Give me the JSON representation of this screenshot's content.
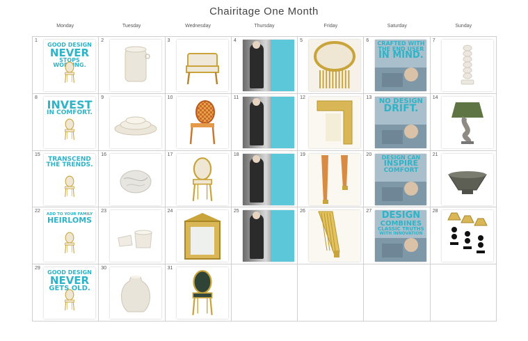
{
  "calendar": {
    "title": "Chairitage One Month",
    "weekdays": [
      "Monday",
      "Tuesday",
      "Wednesday",
      "Thursday",
      "Friday",
      "Saturday",
      "Sunday"
    ],
    "days": [
      {
        "n": "1",
        "kind": "quote",
        "lines": [
          "GOOD DESIGN",
          "NEVER",
          "STOPS WORKING."
        ],
        "sizes": [
          8,
          15,
          8
        ],
        "icon": "gold-chair-icon"
      },
      {
        "n": "2",
        "kind": "product",
        "icon": "ceramic-jar-icon"
      },
      {
        "n": "3",
        "kind": "product",
        "icon": "armchair-icon"
      },
      {
        "n": "4",
        "kind": "bw",
        "icon": "portrait-photo-icon"
      },
      {
        "n": "5",
        "kind": "product",
        "icon": "chair-back-detail-icon"
      },
      {
        "n": "6",
        "kind": "photo",
        "lines": [
          "CRAFTED WITH",
          "THE END USER",
          "IN MIND."
        ],
        "sizes": [
          8,
          8,
          13
        ],
        "icon": "workshop-photo-icon"
      },
      {
        "n": "7",
        "kind": "product",
        "icon": "turned-lamp-base-icon"
      },
      {
        "n": "8",
        "kind": "quote",
        "lines": [
          "INVEST",
          "IN COMFORT."
        ],
        "sizes": [
          16,
          9
        ],
        "icon": "gold-chair-icon"
      },
      {
        "n": "9",
        "kind": "product",
        "icon": "nesting-bowls-icon"
      },
      {
        "n": "10",
        "kind": "product",
        "icon": "checkered-chair-icon"
      },
      {
        "n": "11",
        "kind": "bw",
        "icon": "portrait-photo-icon"
      },
      {
        "n": "12",
        "kind": "product",
        "icon": "gold-frame-detail-icon"
      },
      {
        "n": "13",
        "kind": "photo",
        "lines": [
          "NO DESIGN",
          "DRIFT."
        ],
        "sizes": [
          10,
          14
        ],
        "icon": "workshop-photo-icon"
      },
      {
        "n": "14",
        "kind": "product",
        "icon": "table-lamp-icon"
      },
      {
        "n": "15",
        "kind": "quote",
        "lines": [
          "TRANSCEND",
          "THE TRENDS."
        ],
        "sizes": [
          9,
          9
        ],
        "icon": "gold-chair-icon"
      },
      {
        "n": "16",
        "kind": "product",
        "icon": "marble-bowl-icon"
      },
      {
        "n": "17",
        "kind": "product",
        "icon": "oval-back-chair-icon"
      },
      {
        "n": "18",
        "kind": "bw",
        "icon": "portrait-photo-icon"
      },
      {
        "n": "19",
        "kind": "product",
        "icon": "tapered-leg-icon"
      },
      {
        "n": "20",
        "kind": "photo",
        "lines": [
          "DESIGN CAN",
          "INSPIRE",
          "COMFORT"
        ],
        "sizes": [
          8,
          11,
          9
        ],
        "icon": "workshop-photo-icon"
      },
      {
        "n": "21",
        "kind": "product",
        "icon": "stone-bowl-icon"
      },
      {
        "n": "22",
        "kind": "quote",
        "lines": [
          "ADD TO YOUR FAMILY",
          "HEIRLOMS"
        ],
        "sizes": [
          5.5,
          11
        ],
        "icon": "gold-chair-icon"
      },
      {
        "n": "23",
        "kind": "product",
        "icon": "ceramic-pieces-icon"
      },
      {
        "n": "24",
        "kind": "product",
        "icon": "gilded-mirror-icon"
      },
      {
        "n": "25",
        "kind": "bw",
        "icon": "portrait-photo-icon"
      },
      {
        "n": "26",
        "kind": "product",
        "icon": "fluted-leg-icon"
      },
      {
        "n": "27",
        "kind": "photo",
        "lines": [
          "DESIGN",
          "COMBINES",
          "CLASSIC TRUTHS",
          "WITH INNOVATION"
        ],
        "sizes": [
          13,
          10,
          7,
          6
        ],
        "icon": "workshop-photo-icon"
      },
      {
        "n": "28",
        "kind": "product",
        "icon": "candle-lamps-icon"
      },
      {
        "n": "29",
        "kind": "quote",
        "lines": [
          "GOOD DESIGN",
          "NEVER",
          "GETS OLD."
        ],
        "sizes": [
          8,
          15,
          10
        ],
        "icon": "gold-chair-icon"
      },
      {
        "n": "30",
        "kind": "product",
        "icon": "ceramic-vase-icon"
      },
      {
        "n": "31",
        "kind": "product",
        "icon": "green-chair-icon"
      },
      {
        "n": "",
        "kind": "empty"
      },
      {
        "n": "",
        "kind": "empty"
      },
      {
        "n": "",
        "kind": "empty"
      },
      {
        "n": "",
        "kind": "empty"
      }
    ]
  },
  "colors": {
    "accent": "#2fb3c7",
    "grid": "#cfcfcf",
    "gold": "#c9a43b"
  }
}
